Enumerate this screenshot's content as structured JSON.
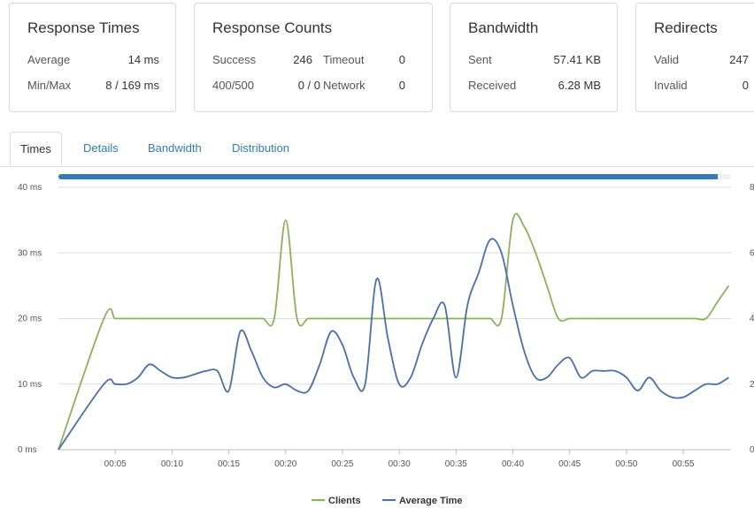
{
  "summary": {
    "response_times": {
      "title": "Response Times",
      "average_label": "Average",
      "average_value": "14 ms",
      "minmax_label": "Min/Max",
      "minmax_value": "8 / 169 ms"
    },
    "response_counts": {
      "title": "Response Counts",
      "success_label": "Success",
      "success_value": "246",
      "timeout_label": "Timeout",
      "timeout_value": "0",
      "errors_label": "400/500",
      "errors_value": "0 / 0",
      "network_label": "Network",
      "network_value": "0"
    },
    "bandwidth": {
      "title": "Bandwidth",
      "sent_label": "Sent",
      "sent_value": "57.41 KB",
      "received_label": "Received",
      "received_value": "6.28 MB"
    },
    "redirects": {
      "title": "Redirects",
      "valid_label": "Valid",
      "valid_value": "247",
      "invalid_label": "Invalid",
      "invalid_value": "0"
    }
  },
  "tabs": [
    {
      "label": "Times",
      "active": true
    },
    {
      "label": "Details",
      "active": false
    },
    {
      "label": "Bandwidth",
      "active": false
    },
    {
      "label": "Distribution",
      "active": false
    }
  ],
  "progress": {
    "value": 0.98,
    "color": "#337ab7"
  },
  "chart_data": {
    "type": "line",
    "x": [
      0,
      4,
      5,
      6,
      7,
      8,
      9,
      10,
      11,
      12,
      13,
      14,
      15,
      16,
      17,
      18,
      19,
      20,
      21,
      22,
      23,
      24,
      25,
      26,
      27,
      28,
      29,
      30,
      31,
      32,
      33,
      34,
      35,
      36,
      37,
      38,
      39,
      40,
      41,
      42,
      43,
      44,
      45,
      46,
      47,
      48,
      49,
      50,
      51,
      52,
      53,
      54,
      55,
      56,
      57,
      58,
      59
    ],
    "series": [
      {
        "name": "Clients",
        "color": "#8db05c",
        "axis": "right",
        "values": [
          0,
          4,
          4,
          4,
          4,
          4,
          4,
          4,
          4,
          4,
          4,
          4,
          4,
          4,
          4,
          4,
          4,
          7,
          4,
          4,
          4,
          4,
          4,
          4,
          4,
          4,
          4,
          4,
          4,
          4,
          4,
          4,
          4,
          4,
          4,
          4,
          4,
          7,
          6.8,
          6,
          5,
          4,
          4,
          4,
          4,
          4,
          4,
          4,
          4,
          4,
          4,
          4,
          4,
          4,
          4,
          4.5,
          5
        ]
      },
      {
        "name": "Average Time",
        "color": "#4a6fa5",
        "axis": "left",
        "values": [
          0,
          10,
          10,
          10,
          11,
          13,
          12,
          11,
          11,
          11.5,
          12,
          12,
          9,
          18,
          15,
          11,
          9.5,
          10,
          9,
          9,
          13,
          18,
          16,
          11,
          10,
          26,
          17,
          10,
          11,
          16,
          20,
          22,
          11,
          22,
          27,
          32,
          30,
          22,
          15,
          11,
          11,
          13,
          14,
          11,
          12,
          12,
          12,
          11,
          9,
          11,
          9,
          8,
          8,
          9,
          10,
          10,
          11
        ]
      }
    ],
    "xticks": [
      "00:05",
      "00:10",
      "00:15",
      "00:20",
      "00:25",
      "00:30",
      "00:35",
      "00:40",
      "00:45",
      "00:50",
      "00:55"
    ],
    "yticks_left": [
      "0 ms",
      "10 ms",
      "20 ms",
      "30 ms",
      "40 ms"
    ],
    "yticks_right": [
      "0",
      "2",
      "4",
      "6",
      "8"
    ],
    "ylim_left": [
      0,
      40
    ],
    "ylim_right": [
      0,
      8
    ],
    "grid": true,
    "legend_position": "bottom-center"
  }
}
